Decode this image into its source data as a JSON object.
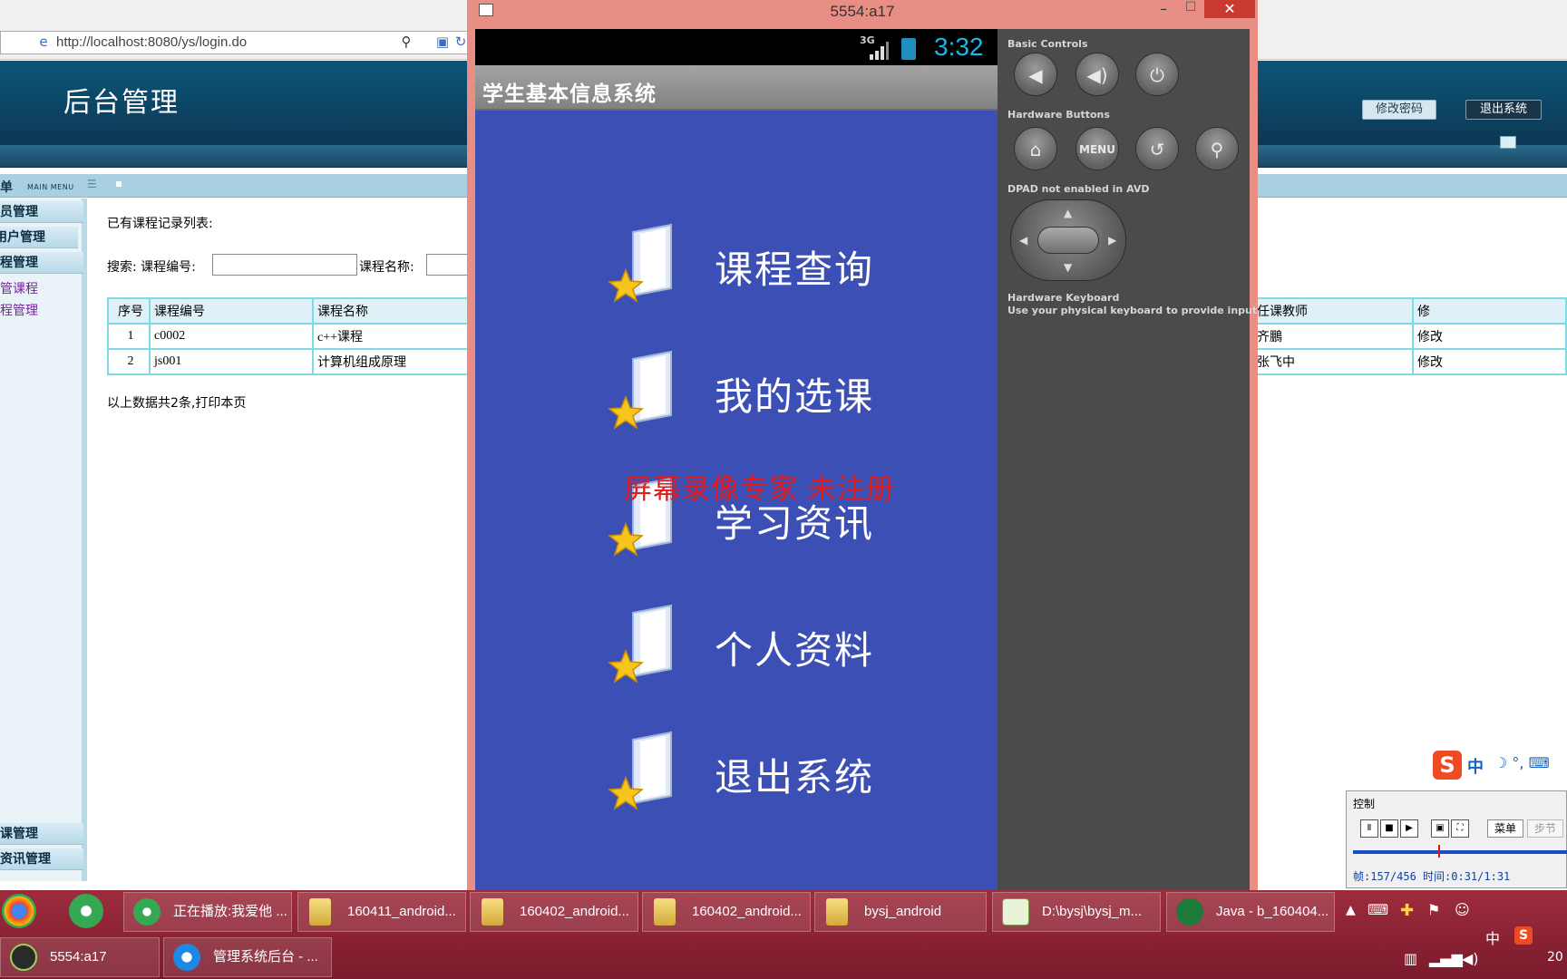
{
  "browser": {
    "url": "http://localhost:8080/ys/login.do"
  },
  "admin": {
    "header_title": "后台管理",
    "change_password": "修改密码",
    "logout": "退出系统",
    "menu_title": "菜单",
    "menu_subtitle": "MAIN MENU",
    "sidebar_groups": [
      "员管理",
      "用户管理",
      "程管理",
      "课管理",
      "资讯管理"
    ],
    "sidebar_links": [
      "管课程",
      "程管理"
    ],
    "content_title": "已有课程记录列表:",
    "search_label": "搜索:  课程编号:",
    "search_label_2": "课程名称:",
    "table_left": {
      "headers": [
        "序号",
        "课程编号",
        "课程名称"
      ],
      "rows": [
        [
          "1",
          "c0002",
          "c++课程"
        ],
        [
          "2",
          "js001",
          "计算机组成原理"
        ]
      ]
    },
    "table_right": {
      "headers": [
        "任课教师",
        "修"
      ],
      "rows": [
        [
          "齐鵬",
          "修改"
        ],
        [
          "张飞中",
          "修改"
        ]
      ]
    },
    "footer_note": "以上数据共2条,打印本页"
  },
  "emulator": {
    "window_title": "5554:a17",
    "status_network": "3G",
    "status_time": "3:32",
    "app_title": "学生基本信息系统",
    "menu_items": [
      {
        "label": "课程查询",
        "icon": "folder-star-icon"
      },
      {
        "label": "我的选课",
        "icon": "folder-star-icon"
      },
      {
        "label": "学习资讯",
        "icon": "folder-star-icon"
      },
      {
        "label": "个人资料",
        "icon": "folder-star-icon"
      },
      {
        "label": "退出系统",
        "icon": "folder-star-icon"
      }
    ],
    "watermark": "屏幕录像专家  未注册",
    "controls": {
      "basic_controls": "Basic Controls",
      "hardware_buttons": "Hardware Buttons",
      "menu_button": "MENU",
      "dpad_notice": "DPAD not enabled in AVD",
      "keyboard_title": "Hardware Keyboard",
      "keyboard_hint": "Use your physical keyboard to provide input"
    }
  },
  "ime": {
    "lang": "中",
    "logo": "S"
  },
  "recorder": {
    "title": "控制",
    "menu": "菜单",
    "step": "步节",
    "info": "帧:157/456 时间:0:31/1:31"
  },
  "taskbar": {
    "items": [
      "正在播放:我爱他 ...",
      "160411_android...",
      "160402_android...",
      "160402_android...",
      "bysj_android",
      "D:\\bysj\\bysj_m...",
      "Java - b_160404..."
    ],
    "second_row": [
      "5554:a17",
      "管理系统后台 - ..."
    ],
    "tray_lang": "中",
    "tray_clock": "20"
  },
  "colors": {
    "phone_bg": "#3b4fb5",
    "watermark": "#e31b1b",
    "taskbar": "#9d2c3d",
    "emulator_frame": "#e98e84"
  }
}
